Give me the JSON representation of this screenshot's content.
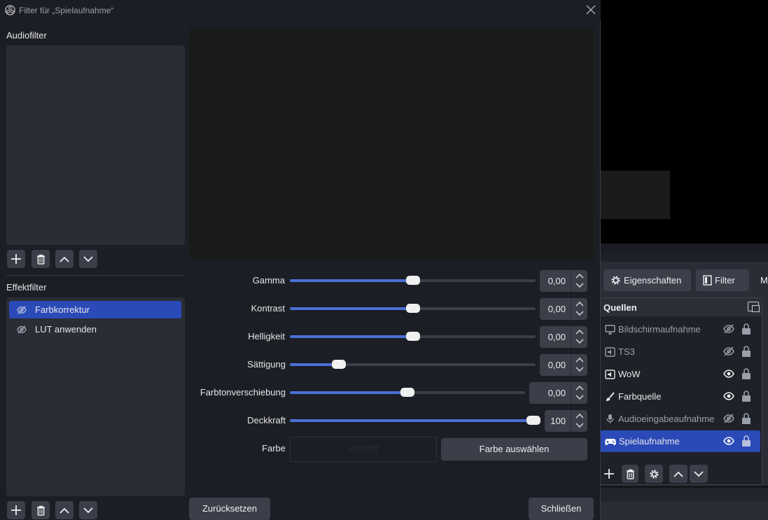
{
  "window": {
    "title": "Filter für „Spielaufnahme“"
  },
  "audio_filters": {
    "label": "Audiofilter",
    "items": []
  },
  "effect_filters": {
    "label": "Effektfilter",
    "items": [
      {
        "label": "Farbkorrektur",
        "selected": true
      },
      {
        "label": "LUT anwenden",
        "selected": false
      }
    ]
  },
  "properties": {
    "gamma": {
      "label": "Gamma",
      "value": "0,00",
      "slider": 0.5
    },
    "contrast": {
      "label": "Kontrast",
      "value": "0,00",
      "slider": 0.5
    },
    "brightness": {
      "label": "Helligkeit",
      "value": "0,00",
      "slider": 0.5
    },
    "saturation": {
      "label": "Sättigung",
      "value": "0,00",
      "slider": 0.18
    },
    "hue_shift": {
      "label": "Farbtonverschiebung",
      "value": "0,00",
      "slider": 0.5
    },
    "opacity": {
      "label": "Deckkraft",
      "value": "100",
      "slider": 1.0
    },
    "color": {
      "label": "Farbe",
      "value": "#00ffffff",
      "button_label": "Farbe auswählen"
    }
  },
  "footer": {
    "reset_label": "Zurücksetzen",
    "close_label": "Schließen"
  },
  "main_window": {
    "properties_label": "Eigenschaften",
    "filters_label": "Filter",
    "more_label": "M",
    "sources": {
      "title": "Quellen",
      "items": [
        {
          "name": "Bildschirmaufnahme",
          "icon": "monitor-icon",
          "visible": false
        },
        {
          "name": "TS3",
          "icon": "audio-output-icon",
          "visible": false
        },
        {
          "name": "WoW",
          "icon": "audio-output-icon",
          "visible": true
        },
        {
          "name": "Farbquelle",
          "icon": "paint-brush-icon",
          "visible": true
        },
        {
          "name": "Audioeingabeaufnahme",
          "icon": "microphone-icon",
          "visible": false
        },
        {
          "name": "Spielaufnahme",
          "icon": "gamepad-icon",
          "visible": true,
          "selected": true
        }
      ]
    }
  },
  "colors": {
    "accent": "#2a4ab8",
    "slider_fill": "#4a6fd6",
    "panel": "#2a2d36",
    "background": "#1c1e25"
  }
}
